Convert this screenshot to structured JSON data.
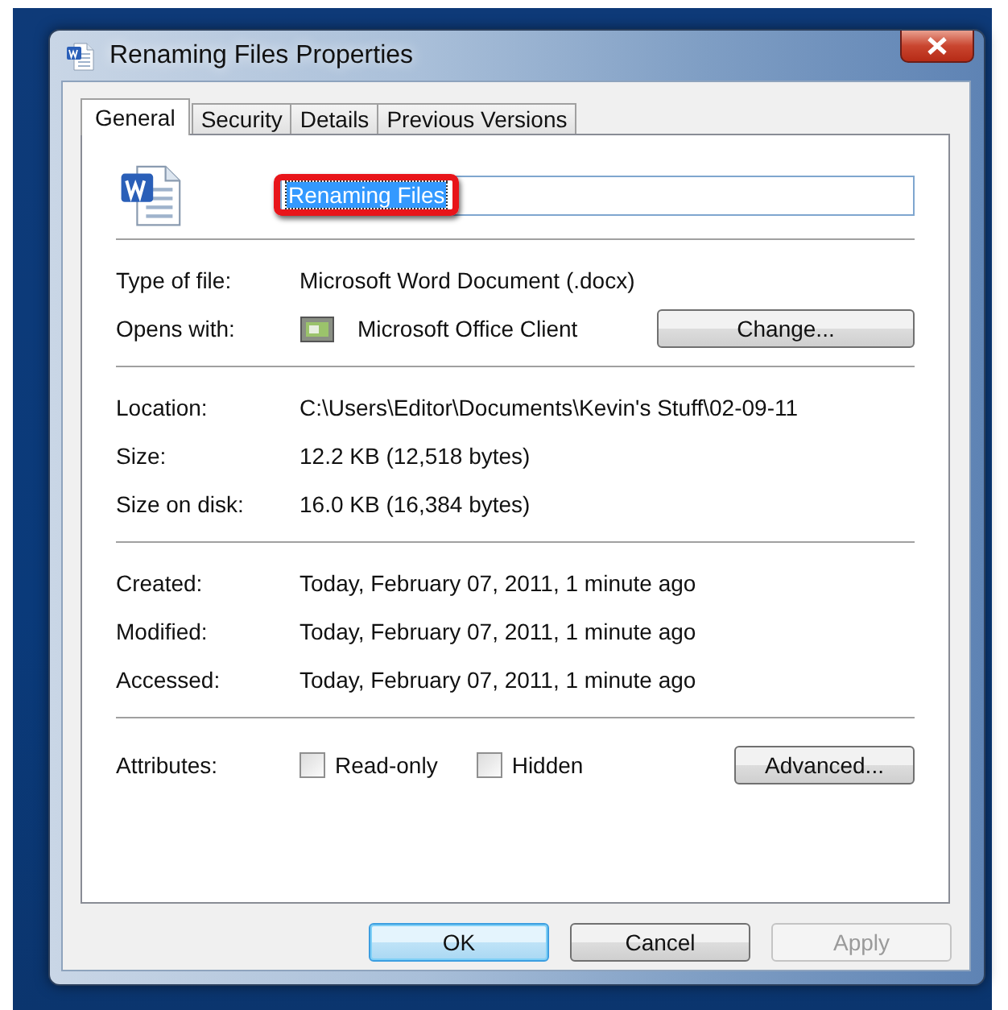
{
  "window": {
    "title": "Renaming Files Properties"
  },
  "tabs": [
    {
      "label": "General",
      "selected": true
    },
    {
      "label": "Security",
      "selected": false
    },
    {
      "label": "Details",
      "selected": false
    },
    {
      "label": "Previous Versions",
      "selected": false
    }
  ],
  "file_name": {
    "value": "Renaming Files",
    "selected": true,
    "highlighted": true
  },
  "groups": [
    {
      "rows": [
        {
          "kind": "text",
          "label": "Type of file:",
          "value": "Microsoft Word Document (.docx)"
        },
        {
          "kind": "app",
          "label": "Opens with:",
          "value": "Microsoft Office Client",
          "button": "Change..."
        }
      ]
    },
    {
      "rows": [
        {
          "kind": "text",
          "label": "Location:",
          "value": "C:\\Users\\Editor\\Documents\\Kevin's Stuff\\02-09-11"
        },
        {
          "kind": "text",
          "label": "Size:",
          "value": "12.2 KB (12,518 bytes)"
        },
        {
          "kind": "text",
          "label": "Size on disk:",
          "value": "16.0 KB (16,384 bytes)"
        }
      ]
    },
    {
      "rows": [
        {
          "kind": "text",
          "label": "Created:",
          "value": "Today, February 07, 2011, 1 minute ago"
        },
        {
          "kind": "text",
          "label": "Modified:",
          "value": "Today, February 07, 2011, 1 minute ago"
        },
        {
          "kind": "text",
          "label": "Accessed:",
          "value": "Today, February 07, 2011, 1 minute ago"
        }
      ]
    },
    {
      "rows": [
        {
          "kind": "attributes",
          "label": "Attributes:",
          "checkboxes": [
            {
              "label": "Read-only",
              "checked": false
            },
            {
              "label": "Hidden",
              "checked": false
            }
          ],
          "button": "Advanced..."
        }
      ]
    }
  ],
  "buttons": [
    {
      "label": "OK",
      "default": true,
      "disabled": false
    },
    {
      "label": "Cancel",
      "default": false,
      "disabled": false
    },
    {
      "label": "Apply",
      "default": false,
      "disabled": true
    }
  ]
}
